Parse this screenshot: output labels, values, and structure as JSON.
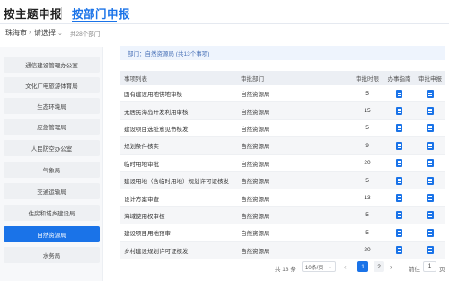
{
  "tabs": {
    "theme": "按主题申报",
    "dept": "按部门申报"
  },
  "filter": {
    "city": "珠海市",
    "select": "请选择",
    "count": "共28个部门"
  },
  "sidebar": {
    "items": [
      "通信建设管理办公室",
      "文化广电旅游体育局",
      "生态环境局",
      "应急管理局",
      "人民防空办公室",
      "气象局",
      "交通运输局",
      "住房和城乡建设局",
      "自然资源局",
      "水务局"
    ],
    "active_index": 8
  },
  "crumb": "部门：自然资源局 (共13个事项)",
  "table": {
    "headers": [
      "事项列表",
      "审批部门",
      "审批时限",
      "办事指南",
      "审批申报"
    ],
    "rows": [
      {
        "name": "国有建设用地供地审核",
        "dept": "自然资源局",
        "days": "5"
      },
      {
        "name": "无居民海岛开发利用审核",
        "dept": "自然资源局",
        "days": "15"
      },
      {
        "name": "建设项目选址意见书核发",
        "dept": "自然资源局",
        "days": "5"
      },
      {
        "name": "规划条件核实",
        "dept": "自然资源局",
        "days": "9"
      },
      {
        "name": "临时用地审批",
        "dept": "自然资源局",
        "days": "20"
      },
      {
        "name": "建设用地（含临时用地）规划许可证核发",
        "dept": "自然资源局",
        "days": "5"
      },
      {
        "name": "设计方案审查",
        "dept": "自然资源局",
        "days": "13"
      },
      {
        "name": "海域使用权审核",
        "dept": "自然资源局",
        "days": "5"
      },
      {
        "name": "建设项目用地预审",
        "dept": "自然资源局",
        "days": "5"
      },
      {
        "name": "乡村建设规划许可证核发",
        "dept": "自然资源局",
        "days": "20"
      }
    ]
  },
  "pagination": {
    "total": "共 13 条",
    "page_size": "10条/页",
    "pages": [
      "1",
      "2"
    ],
    "current": "1",
    "goto_label": "前往",
    "goto_value": "1",
    "goto_unit": "页"
  },
  "colors": {
    "accent": "#1a73e8"
  },
  "icons": {
    "guide": "document-icon",
    "apply": "document-icon",
    "chevron": "chevron-down-icon"
  }
}
